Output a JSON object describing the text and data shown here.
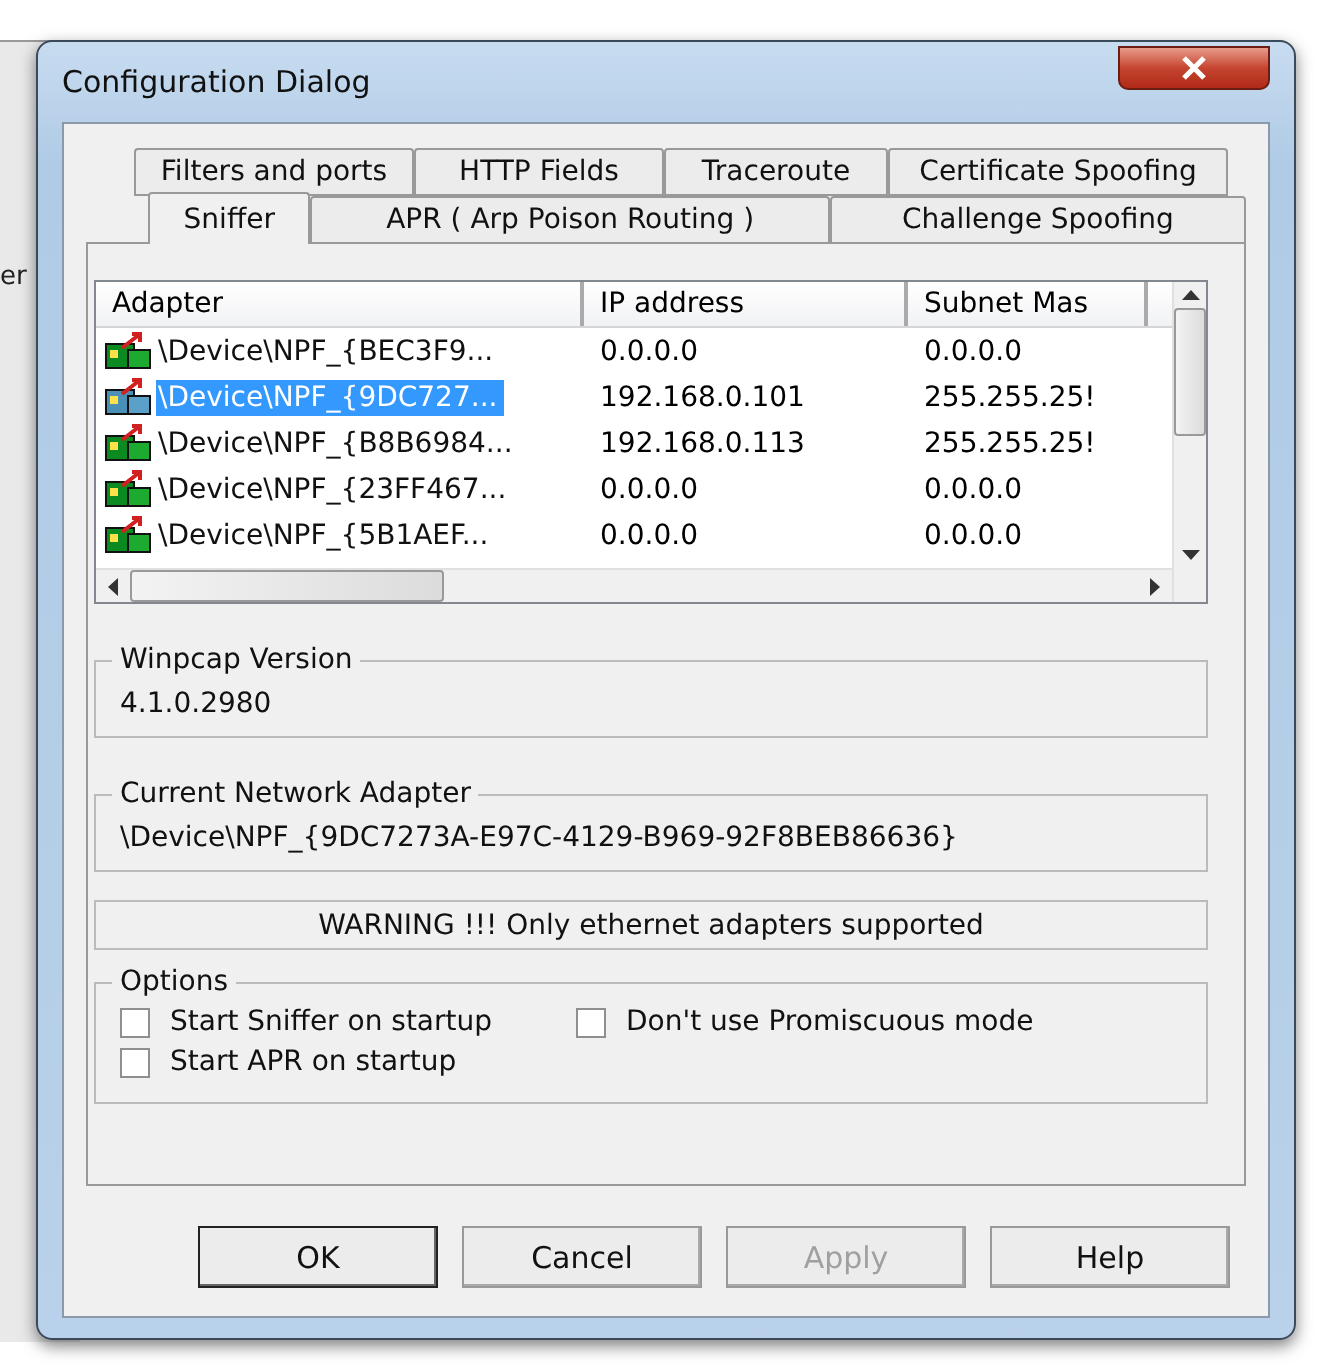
{
  "background_app": {
    "fragment": "er"
  },
  "window": {
    "title": "Configuration Dialog"
  },
  "tab_rows": [
    [
      {
        "label": "Filters and ports",
        "selected": false
      },
      {
        "label": "HTTP Fields",
        "selected": false
      },
      {
        "label": "Traceroute",
        "selected": false
      },
      {
        "label": "Certificate Spoofing",
        "selected": false
      }
    ],
    [
      {
        "label": "Sniffer",
        "selected": true
      },
      {
        "label": "APR ( Arp Poison Routing )",
        "selected": false
      },
      {
        "label": "Challenge Spoofing",
        "selected": false
      }
    ]
  ],
  "adapter_list": {
    "columns": [
      "Adapter",
      "IP address",
      "Subnet Mas"
    ],
    "rows": [
      {
        "adapter": "\\Device\\NPF_{BEC3F9...",
        "ip": "0.0.0.0",
        "subnet": "0.0.0.0",
        "selected": false
      },
      {
        "adapter": "\\Device\\NPF_{9DC727...",
        "ip": "192.168.0.101",
        "subnet": "255.255.25!",
        "selected": true
      },
      {
        "adapter": "\\Device\\NPF_{B8B6984...",
        "ip": "192.168.0.113",
        "subnet": "255.255.25!",
        "selected": false
      },
      {
        "adapter": "\\Device\\NPF_{23FF467...",
        "ip": "0.0.0.0",
        "subnet": "0.0.0.0",
        "selected": false
      },
      {
        "adapter": "\\Device\\NPF_{5B1AEF...",
        "ip": "0.0.0.0",
        "subnet": "0.0.0.0",
        "selected": false
      }
    ]
  },
  "winpcap": {
    "label": "Winpcap Version",
    "value": "4.1.0.2980"
  },
  "current_adapter": {
    "label": "Current Network Adapter",
    "value": "\\Device\\NPF_{9DC7273A-E97C-4129-B969-92F8BEB86636}"
  },
  "warning": "WARNING !!! Only ethernet adapters supported",
  "options": {
    "label": "Options",
    "items": [
      {
        "label": "Start Sniffer on startup",
        "checked": false
      },
      {
        "label": "Don't use Promiscuous mode",
        "checked": false
      },
      {
        "label": "Start APR on startup",
        "checked": false
      }
    ]
  },
  "buttons": [
    {
      "label": "OK",
      "disabled": false,
      "default": true
    },
    {
      "label": "Cancel",
      "disabled": false,
      "default": false
    },
    {
      "label": "Apply",
      "disabled": true,
      "default": false
    },
    {
      "label": "Help",
      "disabled": false,
      "default": false
    }
  ]
}
